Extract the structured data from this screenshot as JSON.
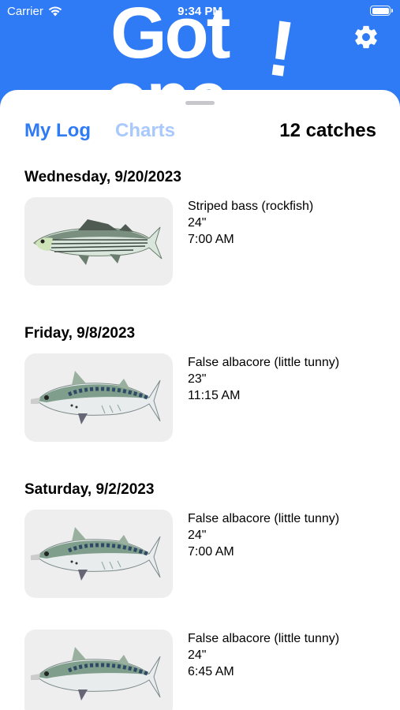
{
  "status_bar": {
    "carrier": "Carrier",
    "time": "9:34 PM"
  },
  "header": {
    "logo_line1": "Got",
    "logo_line2": "one",
    "logo_bang": "!",
    "brand_color": "#2f7af5"
  },
  "tabs": {
    "my_log": "My Log",
    "charts": "Charts",
    "active": "My Log"
  },
  "catch_count": "12 catches",
  "log": [
    {
      "date": "Wednesday, 9/20/2023",
      "catches": [
        {
          "species": "Striped bass (rockfish)",
          "length": "24\"",
          "time": "7:00 AM",
          "fish_icon": "striped-bass"
        }
      ]
    },
    {
      "date": "Friday, 9/8/2023",
      "catches": [
        {
          "species": "False albacore (little tunny)",
          "length": "23\"",
          "time": "11:15 AM",
          "fish_icon": "false-albacore"
        }
      ]
    },
    {
      "date": "Saturday, 9/2/2023",
      "catches": [
        {
          "species": "False albacore (little tunny)",
          "length": "24\"",
          "time": "7:00 AM",
          "fish_icon": "false-albacore"
        },
        {
          "species": "False albacore (little tunny)",
          "length": "24\"",
          "time": "6:45 AM",
          "fish_icon": "false-albacore"
        }
      ]
    }
  ]
}
